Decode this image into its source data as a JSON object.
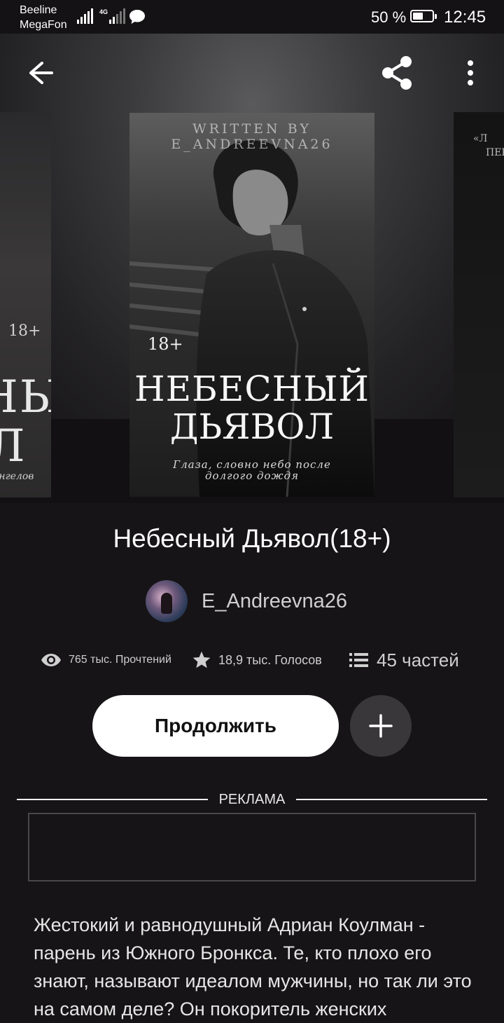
{
  "status_bar": {
    "carrier_1": "Beeline",
    "carrier_2": "MegaFon",
    "network": "4G",
    "battery": "50 %",
    "time": "12:45"
  },
  "toolbar": {
    "back_icon": "arrow-left-icon",
    "share_icon": "share-icon",
    "more_icon": "more-vertical-icon"
  },
  "cover": {
    "written_by": "WRITTEN BY",
    "author_tag": "E_ANDREEVNA26",
    "age": "18+",
    "title_line_1": "НЕБЕСНЫЙ",
    "title_line_2": "ДЬЯВОЛ",
    "subtitle_line_1": "Глаза, словно небо после",
    "subtitle_line_2": "долгого дождя"
  },
  "left_cover": {
    "age": "18+",
    "line_1": "НЫЙ",
    "line_2": "Л",
    "tagline": "ангелов"
  },
  "right_cover": {
    "line_1": "«Л",
    "line_2": "ПЕР"
  },
  "book": {
    "title": "Небесный Дьявол(18+)",
    "author": "E_Andreevna26"
  },
  "stats": {
    "reads": "765 тыс. Прочтений",
    "votes": "18,9 тыс. Голосов",
    "parts": "45 частей"
  },
  "actions": {
    "continue_label": "Продолжить",
    "add_icon": "plus-icon"
  },
  "ad": {
    "label": "РЕКЛАМА"
  },
  "description": "Жестокий и равнодушный Адриан Коулман - парень из Южного Бронкса. Те, кто плохо его знают, называют идеалом мужчины, но так ли это на самом деле? Он покоритель женских"
}
